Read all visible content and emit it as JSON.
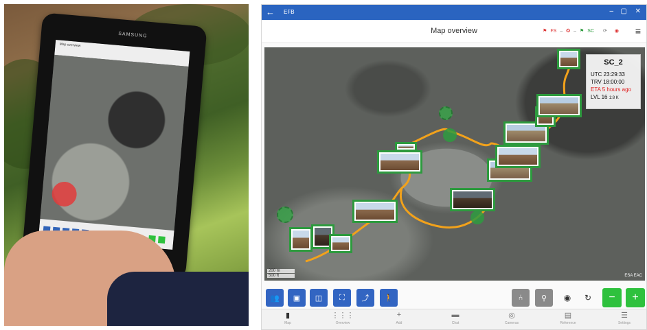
{
  "window": {
    "title": "EFB",
    "back_glyph": "←",
    "minimize_glyph": "–",
    "maximize_glyph": "▢",
    "close_glyph": "✕"
  },
  "header": {
    "title": "Map overview",
    "status": [
      {
        "label": "FS",
        "color": "#d33333"
      },
      {
        "label": "SC",
        "color": "#2e9b3f"
      }
    ],
    "menu_glyph": "≡"
  },
  "photo": {
    "brand_text": "SAMSUNG",
    "screen_title": "Map overview"
  },
  "info": {
    "name": "SC_2",
    "utc": "UTC 23:29:33",
    "trv": "TRV 18:00:00",
    "eta": "ETA 5 hours ago",
    "lvl": "LVL 16",
    "lvl_scale": "1:8 K"
  },
  "map": {
    "scale": [
      "200 m",
      "500 ft"
    ],
    "attribution": "ESA EAC",
    "route_color": "#f2a21b",
    "marker_color": "#2e9b3f"
  },
  "toolbar": {
    "left_buttons": [
      {
        "name": "astronauts-icon",
        "glyph": "👥"
      },
      {
        "name": "image-icon",
        "glyph": "▣"
      },
      {
        "name": "map-icon",
        "glyph": "◫"
      },
      {
        "name": "fit-bounds-icon",
        "glyph": "⛶"
      },
      {
        "name": "trend-icon",
        "glyph": "⤴"
      },
      {
        "name": "walker-icon",
        "glyph": "🚶"
      }
    ],
    "right_buttons": [
      {
        "name": "route-icon",
        "glyph": "⑃"
      },
      {
        "name": "pin-icon",
        "glyph": "⚲"
      },
      {
        "name": "center-icon",
        "glyph": "◉"
      },
      {
        "name": "refresh-icon",
        "glyph": "↻"
      }
    ],
    "zoom_out": "−",
    "zoom_in": "+"
  },
  "nav": [
    {
      "label": "Map",
      "glyph": "▮"
    },
    {
      "label": "Overview",
      "glyph": "⋮⋮⋮"
    },
    {
      "label": "Add",
      "glyph": "+"
    },
    {
      "label": "Chat",
      "glyph": "▬"
    },
    {
      "label": "Cameras",
      "glyph": "◎"
    },
    {
      "label": "Reference",
      "glyph": "▤"
    },
    {
      "label": "Settings",
      "glyph": "☰"
    }
  ]
}
